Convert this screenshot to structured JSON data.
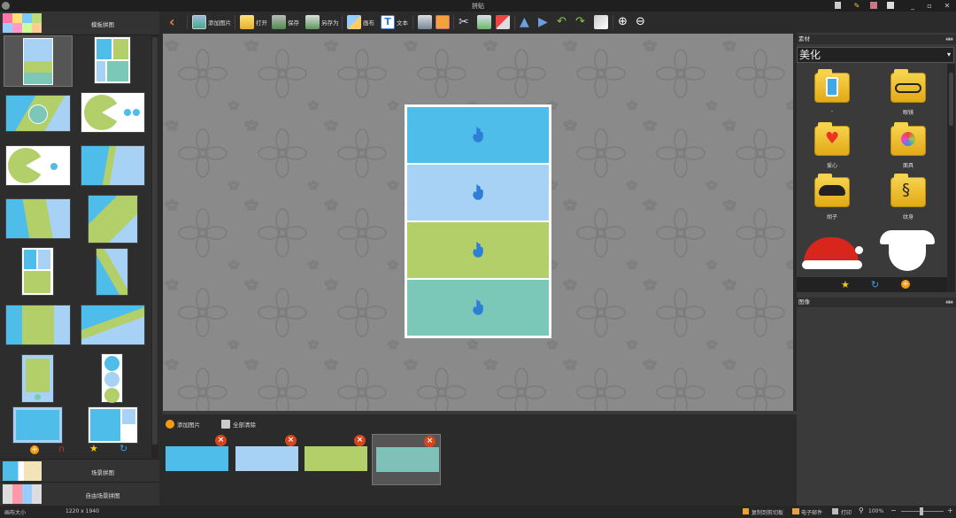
{
  "window": {
    "title": "拼贴",
    "controls": [
      "_",
      "▫",
      "✕"
    ]
  },
  "left": {
    "template_tab": "模板拼图",
    "scene_tab": "场景拼图",
    "free_tab": "自由场景拼图",
    "bottom_icons": [
      "add-icon",
      "magnet-icon",
      "star-icon",
      "refresh-icon"
    ]
  },
  "toolbar": {
    "back": "",
    "add_image": "添加图片",
    "open": "打开",
    "save": "保存",
    "save_as": "另存为",
    "canvas": "画布",
    "text": "文本"
  },
  "bottom": {
    "add_image": "添加图片",
    "clear_all": "全部清除",
    "photos": [
      {
        "color": "#4fbde9"
      },
      {
        "color": "#a7d1f5"
      },
      {
        "color": "#b3cf6a"
      },
      {
        "color": "#7fc1b9"
      }
    ]
  },
  "right": {
    "materials_title": "素材",
    "category": "美化",
    "items": [
      {
        "label": "-",
        "icon": "arrow-up-icon"
      },
      {
        "label": "眼镜",
        "icon": "glasses-icon"
      },
      {
        "label": "爱心",
        "icon": "heart-icon"
      },
      {
        "label": "面具",
        "icon": "mask-icon"
      },
      {
        "label": "胡子",
        "icon": "mustache-icon"
      },
      {
        "label": "纹身",
        "icon": "tattoo-icon"
      }
    ],
    "image_title": "图像"
  },
  "status": {
    "size_label": "画布大小",
    "size_value": "1220 x 1940",
    "copy_clipboard": "复制到剪切板",
    "email": "电子邮件",
    "print": "打印",
    "zoom": "100%"
  },
  "colors": {
    "blue": "#4fbde9",
    "light_blue": "#a7d1f5",
    "green": "#b3cf6a",
    "teal": "#7bc7b8",
    "accent": "#2d7ed6"
  }
}
